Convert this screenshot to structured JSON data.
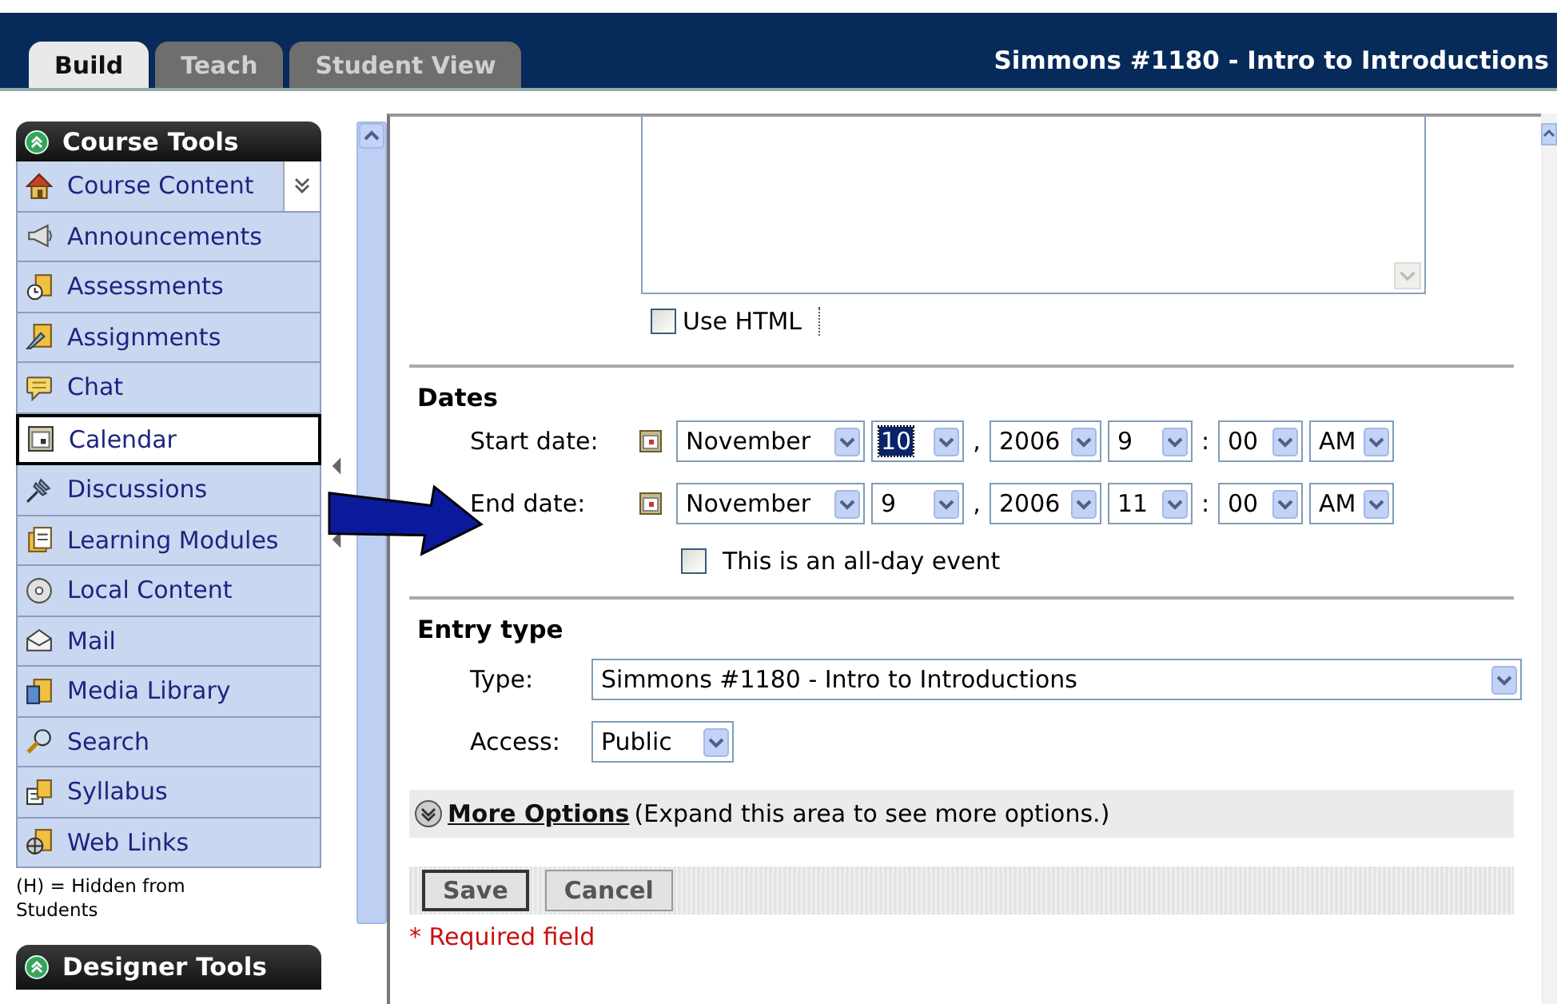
{
  "tabs": [
    {
      "label": "Build",
      "selected": true
    },
    {
      "label": "Teach",
      "selected": false
    },
    {
      "label": "Student View",
      "selected": false
    }
  ],
  "course_title": "Simmons #1180 - Intro to Introductions",
  "sidebar": {
    "title": "Course Tools",
    "items": [
      {
        "label": "Course Content",
        "selected": false,
        "has_menu": true
      },
      {
        "label": "Announcements",
        "selected": false,
        "has_menu": false
      },
      {
        "label": "Assessments",
        "selected": false,
        "has_menu": false
      },
      {
        "label": "Assignments",
        "selected": false,
        "has_menu": false
      },
      {
        "label": "Chat",
        "selected": false,
        "has_menu": false
      },
      {
        "label": "Calendar",
        "selected": true,
        "has_menu": false
      },
      {
        "label": "Discussions",
        "selected": false,
        "has_menu": false
      },
      {
        "label": "Learning Modules",
        "selected": false,
        "has_menu": false
      },
      {
        "label": "Local Content",
        "selected": false,
        "has_menu": false
      },
      {
        "label": "Mail",
        "selected": false,
        "has_menu": false
      },
      {
        "label": "Media Library",
        "selected": false,
        "has_menu": false
      },
      {
        "label": "Search",
        "selected": false,
        "has_menu": false
      },
      {
        "label": "Syllabus",
        "selected": false,
        "has_menu": false
      },
      {
        "label": "Web Links",
        "selected": false,
        "has_menu": false
      }
    ],
    "note": "(H) = Hidden from Students",
    "section_2_title": "Designer Tools"
  },
  "form": {
    "use_html": {
      "label": "Use HTML",
      "checked": false
    },
    "dates": {
      "heading": "Dates",
      "rows": [
        {
          "label": "Start date:",
          "month": "November",
          "day": "10",
          "day_focused": true,
          "date_separator": ",",
          "year": "2006",
          "hour": "9",
          "time_separator": ":",
          "minute": "00",
          "ampm": "AM"
        },
        {
          "label": "End date:",
          "month": "November",
          "day": "9",
          "day_focused": false,
          "date_separator": ",",
          "year": "2006",
          "hour": "11",
          "time_separator": ":",
          "minute": "00",
          "ampm": "AM"
        }
      ]
    },
    "all_day": {
      "label": "This is an all-day event",
      "checked": false
    },
    "entry_type": {
      "heading": "Entry type",
      "type_label": "Type:",
      "type": "Simmons #1180 - Intro to Introductions",
      "access_label": "Access:",
      "access": "Public"
    },
    "more_options": {
      "link": "More Options",
      "hint": "(Expand this area to see more options.)"
    },
    "buttons": [
      {
        "label": "Save",
        "kind": "primary"
      },
      {
        "label": "Cancel",
        "kind": "secondary"
      }
    ],
    "required_note": "* Required field"
  }
}
